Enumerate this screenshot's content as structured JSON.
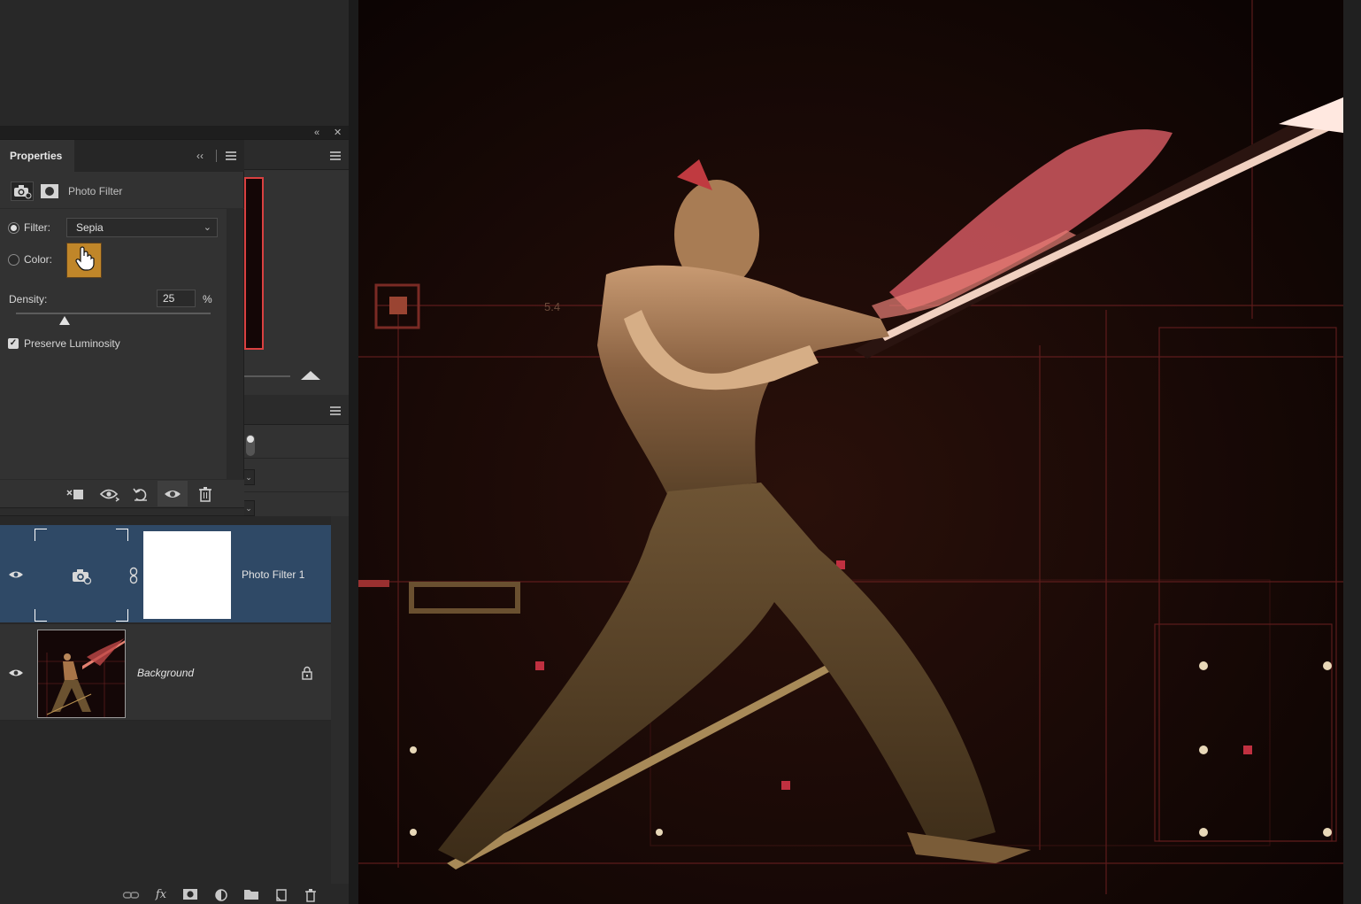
{
  "panel": {
    "tab_label": "Properties",
    "adjustment_name": "Photo Filter",
    "filter_label": "Filter:",
    "filter_value": "Sepia",
    "color_label": "Color:",
    "color_hex": "#c08629",
    "density_label": "Density:",
    "density_value": "25",
    "density_unit": "%",
    "density_level": 0.25,
    "preserve_label": "Preserve Luminosity",
    "preserve_checked": true,
    "filter_selected": true
  },
  "layers": [
    {
      "name": "Photo Filter 1",
      "selected": true,
      "visible": true
    },
    {
      "name": "Background",
      "selected": false,
      "visible": true,
      "locked": true
    }
  ],
  "canvas": {
    "overlay_texts": [
      "5.4"
    ]
  },
  "colors": {
    "panel_bg": "#323232",
    "selected_layer": "#2f4966",
    "filter_color": "#c08629"
  }
}
